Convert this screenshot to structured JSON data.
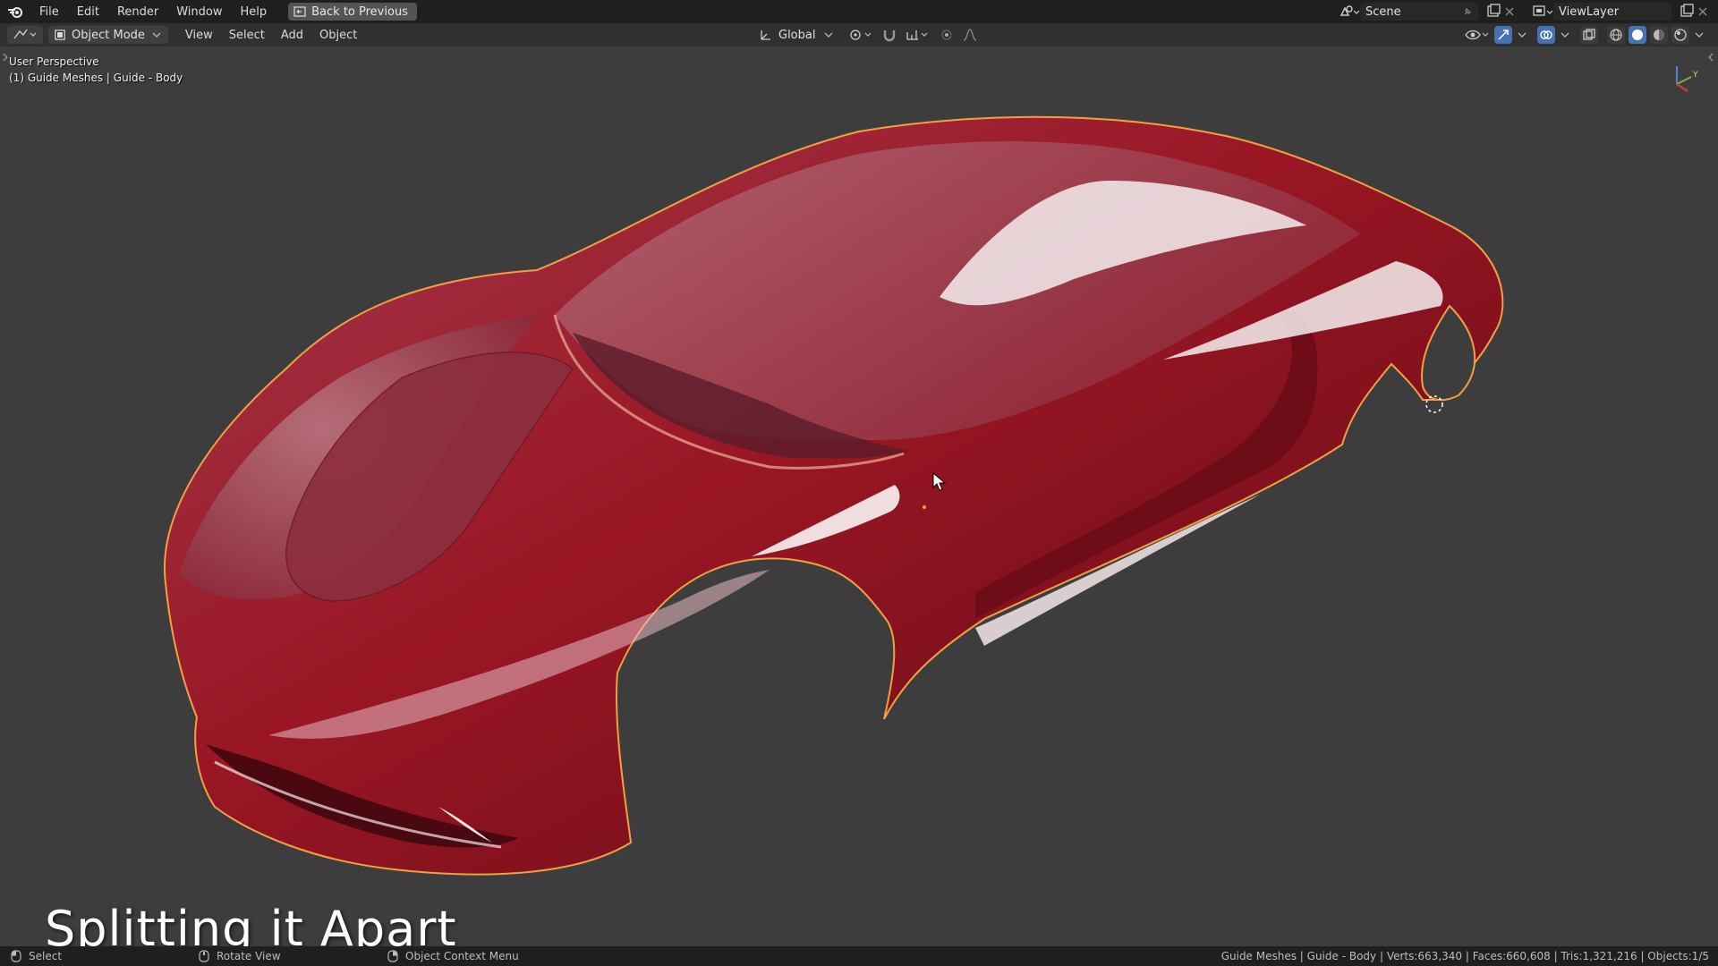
{
  "topbar": {
    "menus": [
      "File",
      "Edit",
      "Render",
      "Window",
      "Help"
    ],
    "back_button": "Back to Previous",
    "scene": "Scene",
    "view_layer": "ViewLayer"
  },
  "header": {
    "mode": "Object Mode",
    "menus": [
      "View",
      "Select",
      "Add",
      "Object"
    ],
    "orientation": "Global"
  },
  "viewport": {
    "perspective_label": "User Perspective",
    "object_label": "(1) Guide Meshes | Guide - Body",
    "gizmo_axes": [
      "Z",
      "Y",
      "X"
    ],
    "caption": "Splitting it Apart"
  },
  "statusbar": {
    "select": "Select",
    "rotate": "Rotate View",
    "context_menu": "Object Context Menu",
    "stats": "Guide Meshes | Guide - Body | Verts:663,340 | Faces:660,608 | Tris:1,321,216 | Objects:1/5"
  },
  "colors": {
    "viewport_bg": "#3d3d3d",
    "topbar_bg": "#1f1f1f",
    "header_bg": "#303030",
    "car_body": "#9e1420",
    "selection_outline": "#f0a043",
    "accent": "#4772b3"
  }
}
